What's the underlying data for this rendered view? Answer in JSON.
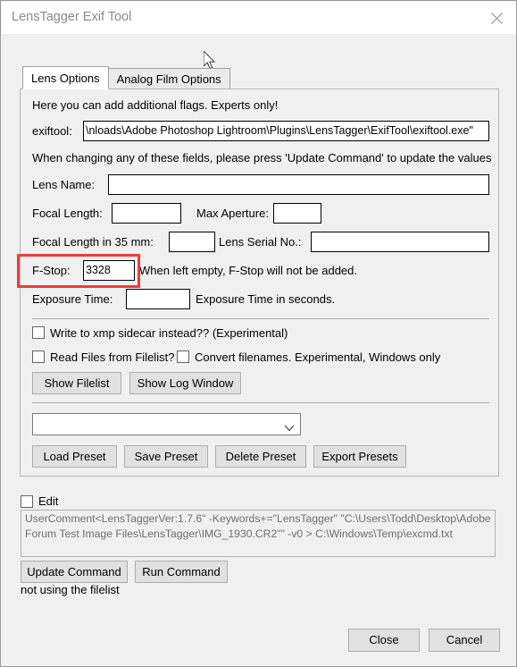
{
  "window": {
    "title": "LensTagger Exif Tool",
    "close_icon": "close-icon"
  },
  "tabs": [
    {
      "label": "Lens Options",
      "active": true
    },
    {
      "label": "Analog Film Options",
      "active": false
    }
  ],
  "panel": {
    "hint_flags": "Here you can add additional flags. Experts only!",
    "exiftool_label": "exiftool:",
    "exiftool_value": "\\nloads\\Adobe Photoshop Lightroom\\Plugins\\LensTagger\\ExifTool\\exiftool.exe\"",
    "hint_update": "When changing any of these fields, please press 'Update Command' to update the values",
    "fields": {
      "lens_name_label": "Lens Name:",
      "lens_name_value": "",
      "focal_length_label": "Focal Length:",
      "focal_length_value": "",
      "max_aperture_label": "Max Aperture:",
      "max_aperture_value": "",
      "focal_length_35_label": "Focal Length in 35 mm:",
      "focal_length_35_value": "",
      "lens_serial_label": "Lens Serial No.:",
      "lens_serial_value": "",
      "fstop_label": "F-Stop:",
      "fstop_value": "3328",
      "fstop_hint": "When left empty, F-Stop will not be added.",
      "exposure_time_label": "Exposure Time:",
      "exposure_time_value": "",
      "exposure_time_hint": "Exposure Time in seconds."
    },
    "checkboxes": {
      "write_xmp_label": "Write to xmp sidecar instead?? (Experimental)",
      "write_xmp_checked": false,
      "read_filelist_label": "Read Files from Filelist?",
      "read_filelist_checked": false,
      "convert_filenames_label": "Convert filenames. Experimental, Windows only",
      "convert_filenames_checked": false
    },
    "buttons": {
      "show_filelist": "Show Filelist",
      "show_log_window": "Show Log Window",
      "load_preset": "Load Preset",
      "save_preset": "Save Preset",
      "delete_preset": "Delete Preset",
      "export_presets": "Export Presets"
    },
    "preset_combo_value": ""
  },
  "bottom": {
    "edit_label": "Edit",
    "edit_checked": false,
    "command_text": "UserComment<LensTaggerVer:1.7.6\" -Keywords+=\"LensTagger\" \"C:\\Users\\Todd\\Desktop\\Adobe Forum Test Image Files\\LensTagger\\IMG_1930.CR2\"\" -v0 > C:\\Windows\\Temp\\excmd.txt",
    "update_command": "Update Command",
    "run_command": "Run Command",
    "status": "not using the filelist",
    "close_button": "Close",
    "cancel_button": "Cancel"
  },
  "annotation": {
    "color": "#ef3b36",
    "target": "fstop-field"
  }
}
